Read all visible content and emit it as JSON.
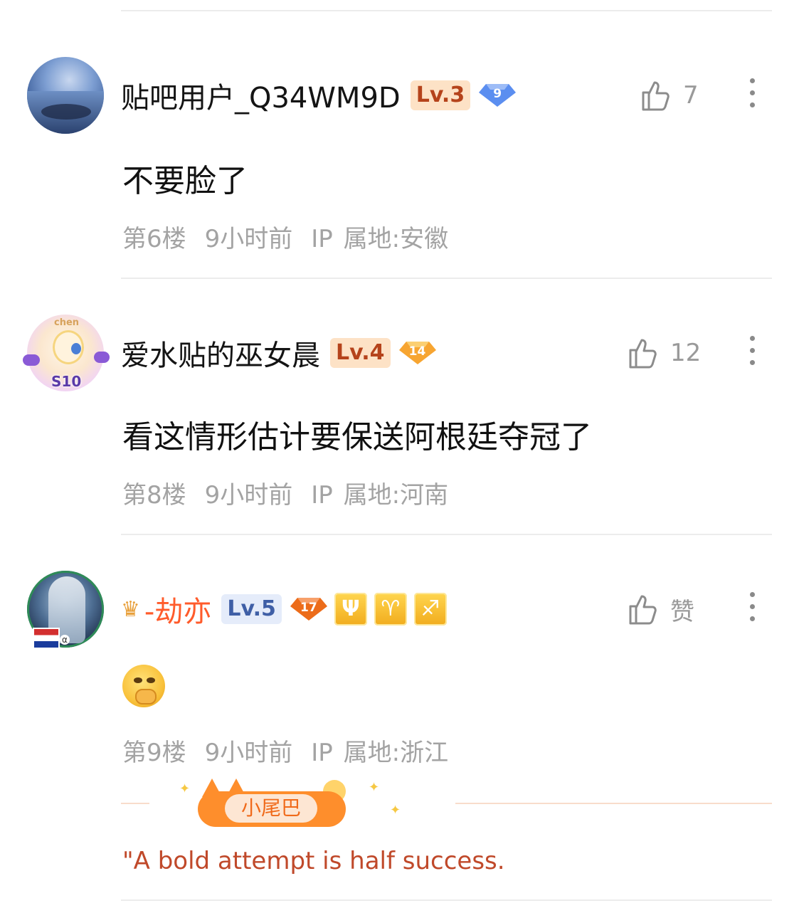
{
  "posts": [
    {
      "username": "贴吧用户_Q34WM9D",
      "level": "Lv.3",
      "gem_number": "9",
      "likes": "7",
      "content": "不要脸了",
      "floor": "第6楼",
      "time": "9小时前",
      "ip": "IP 属地:安徽"
    },
    {
      "username": "爱水贴的巫女晨",
      "level": "Lv.4",
      "gem_number": "14",
      "likes": "12",
      "content": "看这情形估计要保送阿根廷夺冠了",
      "floor": "第8楼",
      "time": "9小时前",
      "ip": "IP 属地:河南",
      "avatar_text": "chen",
      "avatar_badge": "S10"
    },
    {
      "username": "-劫亦",
      "level": "Lv.5",
      "gem_number": "17",
      "likes": "赞",
      "floor": "第9楼",
      "time": "9小时前",
      "ip": "IP 属地:浙江",
      "tags": [
        "Ψ",
        "♈",
        "♐"
      ],
      "avatar_badge": "α"
    }
  ],
  "tail": {
    "label": "小尾巴",
    "signature": "\"A bold attempt is half success."
  },
  "colors": {
    "level_bg": "#fde2c6",
    "level_text": "#b5431b",
    "gem_blue": "#5b8ef0",
    "gem_orange": "#f7a531",
    "gem_dark_orange": "#ec6c1a",
    "username_orange": "#ff5b2b",
    "meta_gray": "#a3a3a3",
    "signature": "#c0492a",
    "divider": "#ececec"
  },
  "icons": [
    "thumbs-up-icon",
    "more-vertical-icon",
    "crown-icon",
    "gem-icon",
    "covering-mouth-emoji-icon"
  ]
}
